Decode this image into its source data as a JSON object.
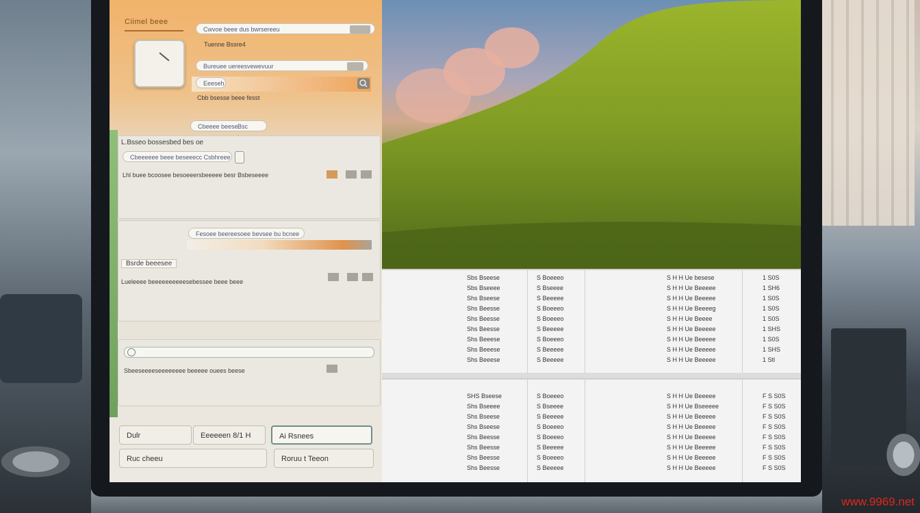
{
  "panel": {
    "title": "Ciimel beee",
    "row1_field": "Cwvoe beee dus bwrsereeu",
    "row1_label": "Tuenne Bssre4",
    "row2_field": "Bureuee uereesvewevuur",
    "row3_field": "Eeeseh",
    "row3_label": "Cbb bsesse beee fesst",
    "row4_field": "Cbeeee beese",
    "row4_extra": "Bsc beese"
  },
  "section1": {
    "header": "L.Bsseo bossesbed bes oe",
    "field": "Cbeeeeee beee beseeecc Csbhreee",
    "desc": "Lhl buee bcoosee besoeeersbeeeee besr Bsbeseeee"
  },
  "section2": {
    "field": "Fesoee beereesoee bevsee bu bcnee",
    "header": "Bsrde beeesee",
    "desc": "Lueleeee beeeeeeeeeesebessee beee beee"
  },
  "section3": {
    "desc": "Sbeeseeeeseeeeeeee beeeee ouees beese"
  },
  "buttons": {
    "b1": "Dulr",
    "b2": "Eeeeeen 8/1 H",
    "b3": "Ai Rsnees",
    "b4": "Ruc cheeu",
    "b5": "Roruu t Teeon"
  },
  "table1": {
    "rows": [
      [
        "Sbs Bseese",
        "S Boeeeo",
        "S H H Ue besese",
        "1 S0S"
      ],
      [
        "Sbs Bseeee",
        "S Bseeee",
        "S H H Ue Beeeee",
        "1 SH6"
      ],
      [
        "Shs Bseese",
        "S Beeeee",
        "S H H Ue Beeeee",
        "1 S0S"
      ],
      [
        "Shs Beesse",
        "S Boeeeo",
        "S H H Ue Beeeeg",
        "1 S0S"
      ],
      [
        "Shs Beesse",
        "S Boeeeo",
        "S H H Ue Beeee",
        "1 S0S"
      ],
      [
        "Shs Beesse",
        "S Beeeee",
        "S H H Ue Beeeee",
        "1 SHS"
      ],
      [
        "Shs Beeese",
        "S Boeeeo",
        "S H H Ue Beeeee",
        "1 S0S"
      ],
      [
        "Shs Beeese",
        "S Beeeee",
        "S H H Ue Beeeee",
        "1 SHS"
      ],
      [
        "Shs Beeese",
        "S Beeeee",
        "S H H Ue Beeeee",
        "1 Stl"
      ]
    ]
  },
  "table2": {
    "rows": [
      [
        "SHS Bseese",
        "S Boeeeo",
        "S H H Ue Beeeee",
        "F S S0S"
      ],
      [
        "Shs Bseeee",
        "S Bseeee",
        "S H H Ue Bseeeee",
        "F S S0S"
      ],
      [
        "Shs Bseese",
        "S Beeeee",
        "S H H Ue Beeeee",
        "F S S0S"
      ],
      [
        "Shs Bseese",
        "S Boeeeo",
        "S H H Ue Beeeee",
        "F S S0S"
      ],
      [
        "Shs Beesse",
        "S Boeeeo",
        "S H H Ue Beeeee",
        "F S S0S"
      ],
      [
        "Shs Beesse",
        "S Beeeee",
        "S H H Ue Beeeee",
        "F S S0S"
      ],
      [
        "Shs Beesse",
        "S Boeeeo",
        "S H H Ue Beeeee",
        "F S S0S"
      ],
      [
        "Shs Beesse",
        "S Beeeee",
        "S H H Ue Beeeee",
        "F S S0S"
      ]
    ]
  },
  "watermark": "www.9969.net"
}
